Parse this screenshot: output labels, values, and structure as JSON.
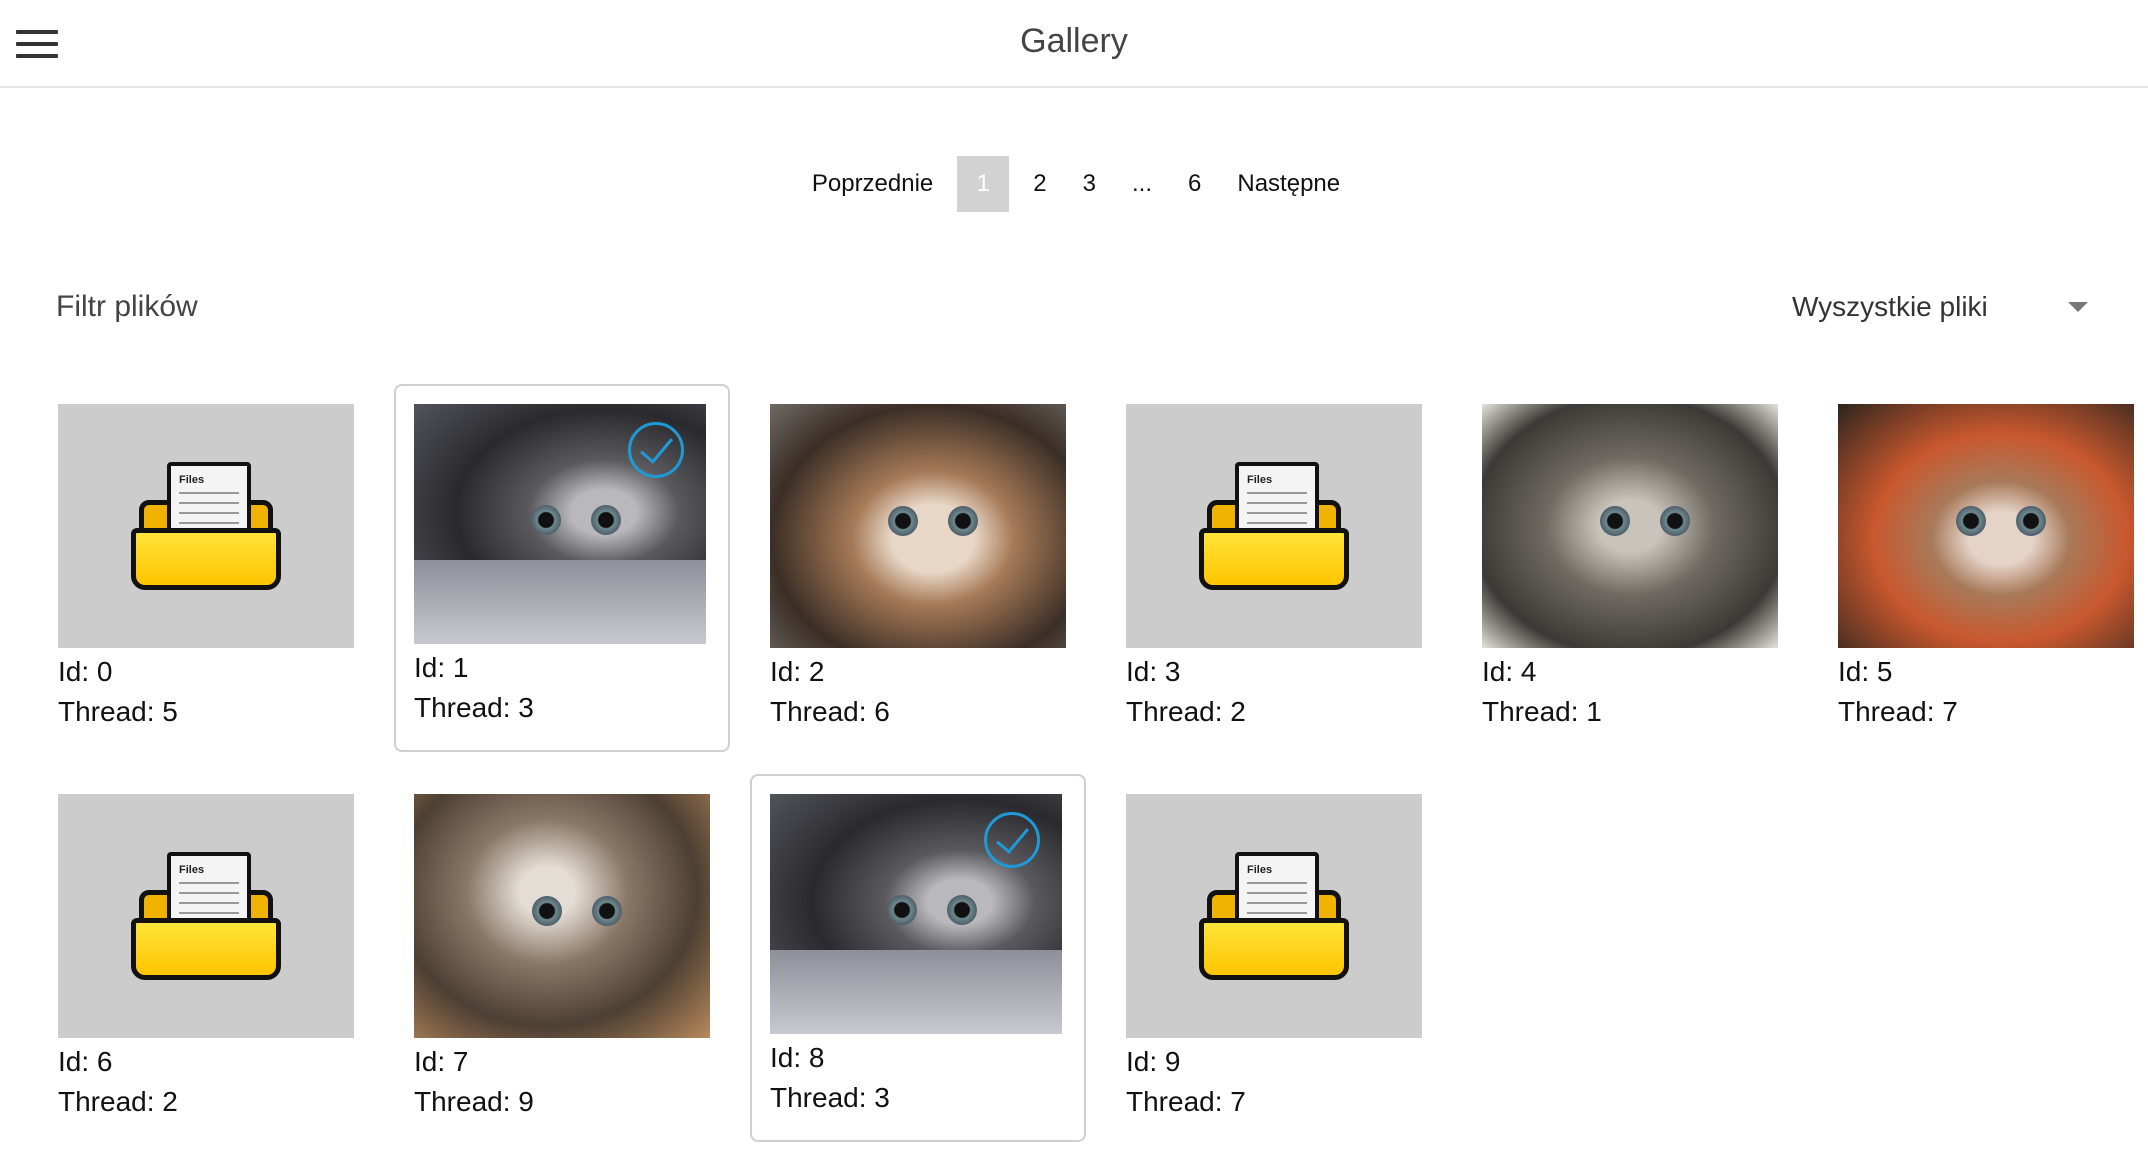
{
  "header": {
    "title": "Gallery",
    "menu_icon": "hamburger-menu-icon"
  },
  "pagination": {
    "prev_label": "Poprzednie",
    "next_label": "Następne",
    "pages": [
      "1",
      "2",
      "3",
      "...",
      "6"
    ],
    "current": "1"
  },
  "filter": {
    "label": "Filtr plików",
    "selected": "Wyszystkie pliki"
  },
  "items": [
    {
      "id": "Id: 0",
      "thread": "Thread: 5",
      "kind": "folder",
      "selected": false
    },
    {
      "id": "Id: 1",
      "thread": "Thread: 3",
      "kind": "cat",
      "selected": true
    },
    {
      "id": "Id: 2",
      "thread": "Thread: 6",
      "kind": "cat",
      "selected": false
    },
    {
      "id": "Id: 3",
      "thread": "Thread: 2",
      "kind": "folder",
      "selected": false
    },
    {
      "id": "Id: 4",
      "thread": "Thread: 1",
      "kind": "cat",
      "selected": false
    },
    {
      "id": "Id: 5",
      "thread": "Thread: 7",
      "kind": "cat",
      "selected": false
    },
    {
      "id": "Id: 6",
      "thread": "Thread: 2",
      "kind": "folder",
      "selected": false
    },
    {
      "id": "Id: 7",
      "thread": "Thread: 9",
      "kind": "cat",
      "selected": false
    },
    {
      "id": "Id: 8",
      "thread": "Thread: 3",
      "kind": "cat",
      "selected": true
    },
    {
      "id": "Id: 9",
      "thread": "Thread: 7",
      "kind": "folder",
      "selected": false
    }
  ],
  "folder_icon_text": "Files",
  "colors": {
    "accent": "#1e9ad6",
    "active_page": "#d2d2d2",
    "thumb_bg": "#cccccc"
  }
}
